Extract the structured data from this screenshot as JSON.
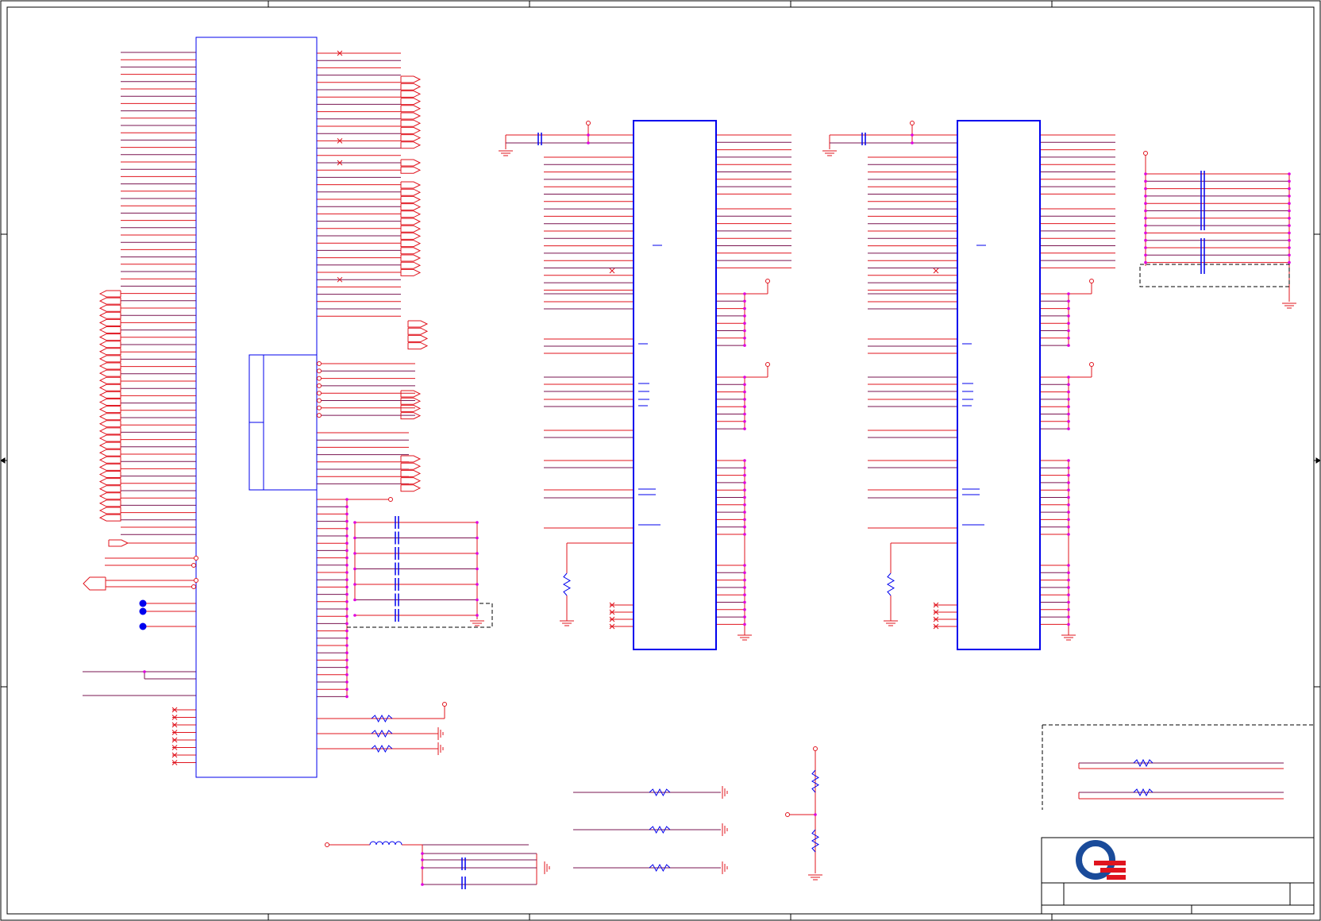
{
  "diagram": {
    "type": "schematic",
    "background_color": "#ffffff",
    "colors": {
      "frame": "#000000",
      "net_wire": "#e0141e",
      "bus_wire": "#7a1450",
      "component_outline": "#0000ee",
      "junction": "#e000e0",
      "no_connect": "#e0141e",
      "test_point": "#0000ee",
      "logo_blue": "#1a4b9a",
      "logo_red": "#e0141e"
    },
    "printed_text": [],
    "title_block": {
      "logo_icon": "quanta-q-logo-icon",
      "fields": []
    }
  }
}
